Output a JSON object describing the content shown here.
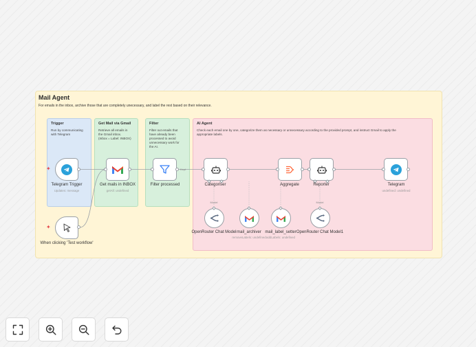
{
  "main_note": {
    "title": "Mail Agent",
    "description": "For emails in the inbox, archive those that are completely unecessary, and label the rest based on their relevance."
  },
  "sections": {
    "trigger": {
      "title": "Trigger",
      "description": "Run by communicating\nwith Telegram"
    },
    "gmail": {
      "title": "Get Mail via Gmail",
      "description": "Retrieve all emails in\nthe Gmail inbox.\n(Inbox = Label: INBOX)"
    },
    "filter": {
      "title": "Filter",
      "description": "Filter out emails that\nhave already been\nprocessed to avoid\nunnecessary work for\nthe AI."
    },
    "agent": {
      "title": "AI Agent",
      "description": "Check each email one by one, categorize them as necessary or unnecessary according to the provided prompt, and instruct Gmail to apply the\nappropriate labels."
    }
  },
  "nodes": {
    "telegram_trigger": {
      "label": "Telegram Trigger",
      "sub": "Updates: message",
      "icon": "telegram-icon"
    },
    "get_mails": {
      "label": "Get mails in INBOX",
      "sub": "getAll: undefined",
      "icon": "gmail-icon"
    },
    "filter_processed": {
      "label": "Filter processed",
      "icon": "filter-icon"
    },
    "categoriser": {
      "label": "Categoriser",
      "icon": "robot-icon"
    },
    "aggregate": {
      "label": "Aggregate",
      "icon": "aggregate-icon"
    },
    "reporter": {
      "label": "Reporter",
      "icon": "robot-icon"
    },
    "telegram": {
      "label": "Telegram",
      "sub": "undefined: undefined",
      "icon": "telegram-icon"
    },
    "manual_trigger": {
      "label": "When clicking 'Test workflow'",
      "icon": "cursor-icon"
    },
    "openrouter1": {
      "label": "OpenRouter Chat Model",
      "tag": "Model",
      "icon": "openrouter-icon"
    },
    "mail_archiver": {
      "label": "mail_archiver",
      "sub": "removeLabels: undefined",
      "icon": "gmail-icon"
    },
    "mail_label_setter": {
      "label": "mail_label_setter",
      "sub": "addLabels: undefined",
      "icon": "gmail-icon"
    },
    "openrouter2": {
      "label": "OpenRouter Chat Model1",
      "tag": "Model",
      "icon": "openrouter-icon"
    }
  },
  "edges": {
    "filter_label": "Kept"
  },
  "toolbar": {
    "fit": "fit-view-icon",
    "zoom_in": "zoom-in-icon",
    "zoom_out": "zoom-out-icon",
    "undo": "undo-icon"
  },
  "colors": {
    "trigger_section": "#dbe8f7",
    "gmail_section": "#d7f0dc",
    "filter_section": "#d7f0dc",
    "agent_section": "#fbdde2",
    "main_note": "#fff5d6",
    "telegram": "#2aa1da",
    "filter": "#3b82f6",
    "aggregate": "#ff6a3d",
    "trigger_bolt": "#e5484d"
  }
}
